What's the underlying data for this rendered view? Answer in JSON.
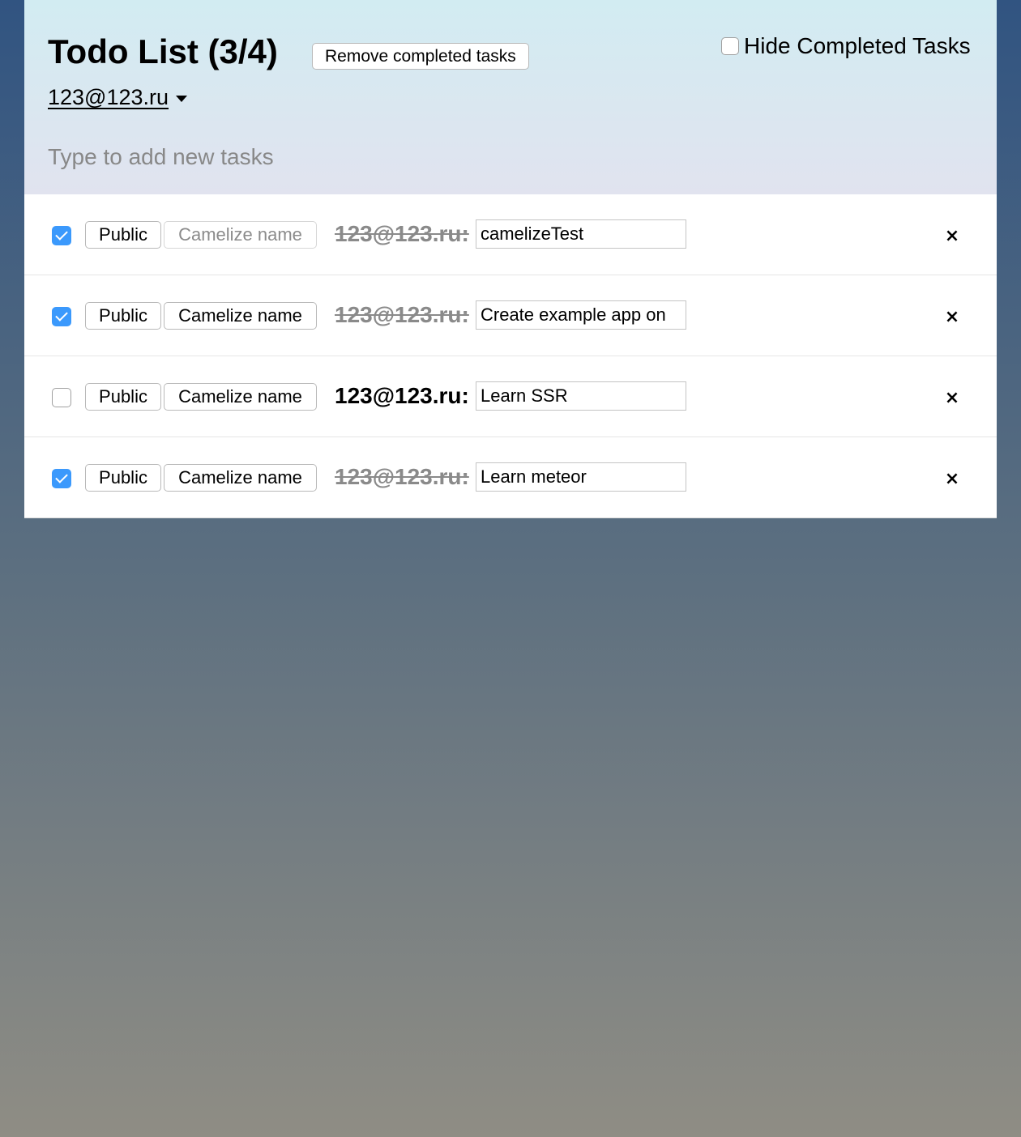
{
  "header": {
    "title": "Todo List (3/4)",
    "remove_completed_label": "Remove completed tasks",
    "hide_completed_label": "Hide Completed Tasks",
    "hide_completed_checked": false,
    "account": "123@123.ru",
    "new_task_placeholder": "Type to add new tasks"
  },
  "tasks": [
    {
      "checked": true,
      "public_label": "Public",
      "camelize_label": "Camelize name",
      "camelize_disabled": true,
      "owner": "123@123.ru:",
      "text": "camelizeTest",
      "delete_icon": "×"
    },
    {
      "checked": true,
      "public_label": "Public",
      "camelize_label": "Camelize name",
      "camelize_disabled": false,
      "owner": "123@123.ru:",
      "text": "Create example app on",
      "delete_icon": "×"
    },
    {
      "checked": false,
      "public_label": "Public",
      "camelize_label": "Camelize name",
      "camelize_disabled": false,
      "owner": "123@123.ru:",
      "text": "Learn SSR",
      "delete_icon": "×"
    },
    {
      "checked": true,
      "public_label": "Public",
      "camelize_label": "Camelize name",
      "camelize_disabled": false,
      "owner": "123@123.ru:",
      "text": "Learn meteor",
      "delete_icon": "×"
    }
  ],
  "colors": {
    "checkbox_accent": "#3b99fc",
    "completed_text": "#8a8a8a",
    "header_gradient_top": "#d2ecf2",
    "header_gradient_bottom": "#e1e3ef"
  }
}
